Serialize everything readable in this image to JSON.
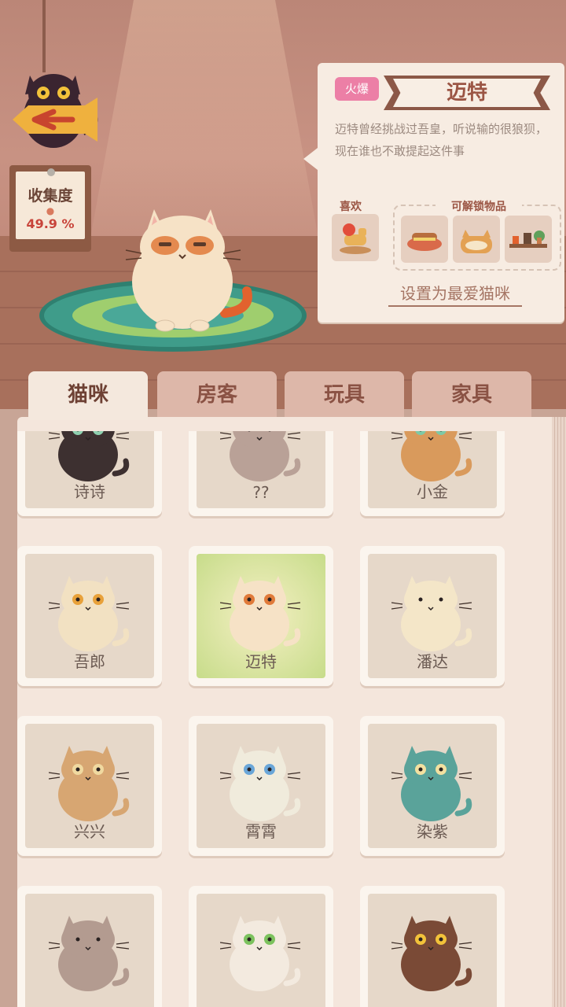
{
  "collection": {
    "label": "收集度",
    "value": "49.9 %"
  },
  "detail": {
    "tag": "火爆",
    "name": "迈特",
    "description": "迈特曾经挑战过吾皇，听说输的很狼狈，现在谁也不敢提起这件事",
    "likes_label": "喜欢",
    "unlock_label": "可解锁物品",
    "set_favorite": "设置为最爱猫咪"
  },
  "tabs": [
    {
      "label": "猫咪",
      "active": true
    },
    {
      "label": "房客",
      "active": false
    },
    {
      "label": "玩具",
      "active": false
    },
    {
      "label": "家具",
      "active": false
    }
  ],
  "cats": [
    {
      "name": "诗诗",
      "body": "#3d3030",
      "eye": "#8fd0b0"
    },
    {
      "name": "??",
      "body": "#b9a197",
      "eye": "#b9a197"
    },
    {
      "name": "小金",
      "body": "#d99a5c",
      "eye": "#7ec9a6"
    },
    {
      "name": "吾郎",
      "body": "#f2e1c2",
      "eye": "#e8a13a"
    },
    {
      "name": "迈特",
      "body": "#f6e2c6",
      "eye": "#e07a3a",
      "selected": true
    },
    {
      "name": "潘达",
      "body": "#f4e6c8",
      "eye": "#f4e6c8"
    },
    {
      "name": "兴兴",
      "body": "#d7a672",
      "eye": "#f0d9a0"
    },
    {
      "name": "霄霄",
      "body": "#f0ebdc",
      "eye": "#6aa6d8"
    },
    {
      "name": "染紫",
      "body": "#5aa39a",
      "eye": "#f2e0a0"
    },
    {
      "name": "",
      "body": "#b39b90",
      "eye": "#b39b90"
    },
    {
      "name": "",
      "body": "#f3eadf",
      "eye": "#7cc25e"
    },
    {
      "name": "",
      "body": "#7a4a36",
      "eye": "#f2c23a"
    }
  ],
  "colors": {
    "accent": "#8c5847",
    "tag_pink": "#ec7fa6",
    "book_page": "#f4e6dc"
  }
}
